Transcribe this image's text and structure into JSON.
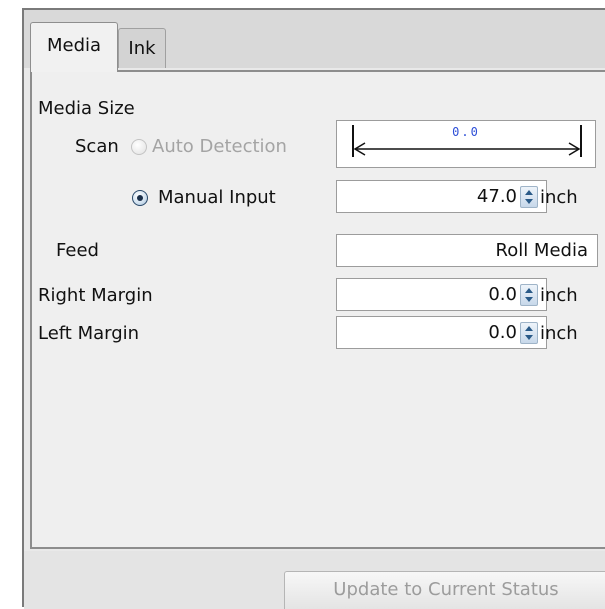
{
  "tabs": [
    {
      "label": "Media",
      "active": true
    },
    {
      "label": "Ink",
      "active": false
    }
  ],
  "media_size": {
    "title": "Media Size",
    "scan_label": "Scan",
    "auto_detection_label": "Auto Detection",
    "auto_detection_enabled": false,
    "auto_detection_selected": false,
    "ruler_value": "0.0",
    "manual_input_label": "Manual Input",
    "manual_input_selected": true,
    "manual_value": "47.0",
    "manual_unit": "inch"
  },
  "feed": {
    "label": "Feed",
    "value": "Roll Media"
  },
  "right_margin": {
    "label": "Right Margin",
    "value": "0.0",
    "unit": "inch"
  },
  "left_margin": {
    "label": "Left Margin",
    "value": "0.0",
    "unit": "inch"
  },
  "footer": {
    "update_button_label": "Update to Current Status",
    "update_button_enabled": false
  },
  "colors": {
    "ruler_value_text": "#2d4fd8",
    "disabled_text": "#a4a4a4",
    "radio_selected": "#1a2f4a"
  },
  "icons": {
    "spinner": "spinner-arrows-icon",
    "radio_selected": "radio-selected-icon",
    "radio_unselected": "radio-unselected-icon"
  }
}
